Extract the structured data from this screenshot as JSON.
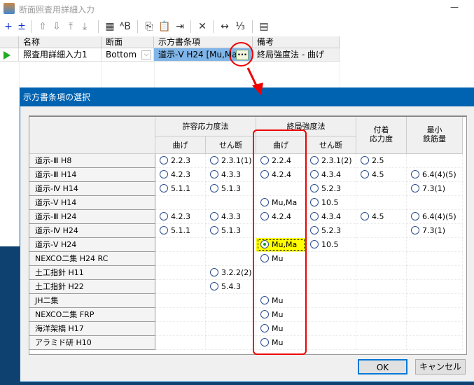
{
  "window": {
    "title": "断面照査用詳細入力",
    "minimize": "—"
  },
  "toolbar": {
    "icons": [
      "add-icon",
      "insert-icon",
      "move-up-icon",
      "move-down-icon",
      "move-top-icon",
      "move-bottom-icon",
      "edit-table-icon",
      "rename-icon",
      "copy-icon",
      "paste-icon",
      "paste-insert-icon",
      "delete-icon",
      "expand-width-icon",
      "number-format-icon",
      "export-icon"
    ]
  },
  "grid": {
    "columns": [
      "名称",
      "断面",
      "示方書条項",
      "備考"
    ],
    "rows": [
      {
        "name": "照査用詳細入力1",
        "section": "Bottom",
        "clause": "道示-V H24 [Mu,Ma]",
        "ellipsis": "···",
        "note": "終局強度法 - 曲げ"
      }
    ]
  },
  "dialog": {
    "title": "示方書条項の選択",
    "group_headers": [
      "許容応力度法",
      "終局強度法",
      "付着\n応力度",
      "最小\n鉄筋量"
    ],
    "sub_headers": [
      "曲げ",
      "せん断",
      "曲げ",
      "せん断"
    ],
    "rows": [
      {
        "label": "道示-Ⅲ H8",
        "cells": [
          "2.2.3",
          "2.3.1(1)",
          "2.2.4",
          "2.3.1(2)",
          "2.5",
          ""
        ]
      },
      {
        "label": "道示-Ⅲ H14",
        "cells": [
          "4.2.3",
          "4.3.3",
          "4.2.4",
          "4.3.4",
          "4.5",
          "6.4(4)(5)"
        ]
      },
      {
        "label": "道示-Ⅳ H14",
        "cells": [
          "5.1.1",
          "5.1.3",
          "",
          "5.2.3",
          "",
          "7.3(1)"
        ]
      },
      {
        "label": "道示-V H14",
        "cells": [
          "",
          "",
          "Mu,Ma",
          "10.5",
          "",
          ""
        ]
      },
      {
        "label": "道示-Ⅲ H24",
        "cells": [
          "4.2.3",
          "4.3.3",
          "4.2.4",
          "4.3.4",
          "4.5",
          "6.4(4)(5)"
        ]
      },
      {
        "label": "道示-Ⅳ H24",
        "cells": [
          "5.1.1",
          "5.1.3",
          "",
          "5.2.3",
          "",
          "7.3(1)"
        ]
      },
      {
        "label": "道示-V H24",
        "cells": [
          "",
          "",
          "Mu,Ma",
          "10.5",
          "",
          ""
        ]
      },
      {
        "label": "NEXCO二集 H24 RC",
        "cells": [
          "",
          "",
          "Mu",
          "",
          "",
          ""
        ]
      },
      {
        "label": "土工指針 H11",
        "cells": [
          "",
          "3.2.2(2)",
          "",
          "",
          "",
          ""
        ]
      },
      {
        "label": "土工指針 H22",
        "cells": [
          "",
          "5.4.3",
          "",
          "",
          "",
          ""
        ]
      },
      {
        "label": "JH二集",
        "cells": [
          "",
          "",
          "Mu",
          "",
          "",
          ""
        ]
      },
      {
        "label": "NEXCO二集 FRP",
        "cells": [
          "",
          "",
          "Mu",
          "",
          "",
          ""
        ]
      },
      {
        "label": "海洋架橋 H17",
        "cells": [
          "",
          "",
          "Mu",
          "",
          "",
          ""
        ]
      },
      {
        "label": "アラミド研 H10",
        "cells": [
          "",
          "",
          "Mu",
          "",
          "",
          ""
        ]
      }
    ],
    "selected": {
      "row": 6,
      "col": 2
    },
    "ok": "OK",
    "cancel": "キャンセル"
  },
  "colors": {
    "title_bar": "#0063b1",
    "selection_highlight": "#ffff00",
    "annotation": "#e00000",
    "selected_cell": "#7fb5e8"
  }
}
